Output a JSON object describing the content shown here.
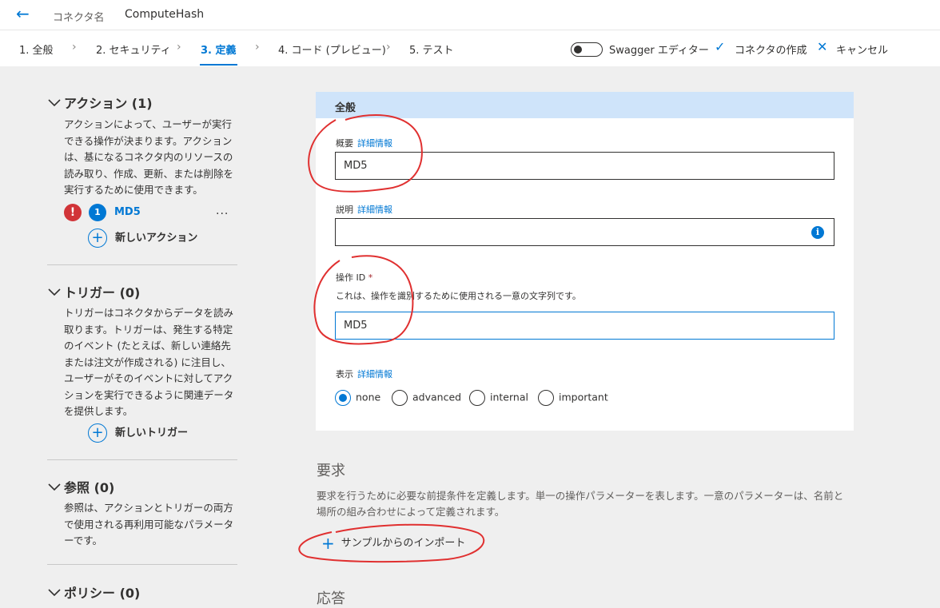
{
  "header": {
    "back_icon": "arrow-left-icon",
    "connector_label": "コネクタ名",
    "connector_name": "ComputeHash"
  },
  "tabs": [
    {
      "label": "1. 全般"
    },
    {
      "label": "2. セキュリティ"
    },
    {
      "label": "3. 定義",
      "active": true
    },
    {
      "label": "4. コード (プレビュー)"
    },
    {
      "label": "5. テスト"
    }
  ],
  "toolbar": {
    "swagger_label": "Swagger エディター",
    "create_label": "コネクタの作成",
    "cancel_label": "キャンセル"
  },
  "sidebar": {
    "actions": {
      "title": "アクション (1)",
      "description": "アクションによって、ユーザーが実行できる操作が決まります。アクションは、基になるコネクタ内のリソースの読み取り、作成、更新、または削除を実行するために使用できます。",
      "item_badge": "1",
      "item_name": "MD5",
      "more": "...",
      "add_label": "新しいアクション"
    },
    "triggers": {
      "title": "トリガー (0)",
      "description": "トリガーはコネクタからデータを読み取ります。トリガーは、発生する特定のイベント (たとえば、新しい連絡先または注文が作成される) に注目し、ユーザーがそのイベントに対してアクションを実行できるように関連データを提供します。",
      "add_label": "新しいトリガー"
    },
    "references": {
      "title": "参照 (0)",
      "description": "参照は、アクションとトリガーの両方で使用される再利用可能なパラメーターです。"
    },
    "policies": {
      "title": "ポリシー (0)"
    }
  },
  "general": {
    "title": "全般",
    "summary_label": "概要",
    "summary_link": "詳細情報",
    "summary_value": "MD5",
    "description_label": "説明",
    "description_link": "詳細情報",
    "description_value": "",
    "operation_id_label": "操作 ID",
    "required_mark": "*",
    "operation_id_help": "これは、操作を識別するために使用される一意の文字列です。",
    "operation_id_value": "MD5",
    "visibility_label": "表示",
    "visibility_link": "詳細情報",
    "visibility_options": [
      "none",
      "advanced",
      "internal",
      "important"
    ],
    "visibility_selected": "none"
  },
  "request": {
    "title": "要求",
    "description": "要求を行うために必要な前提条件を定義します。単一の操作パラメーターを表します。一意のパラメーターは、名前と場所の組み合わせによって定義されます。",
    "import_label": "サンプルからのインポート"
  },
  "response": {
    "title": "応答"
  },
  "colors": {
    "accent": "#0078d4",
    "error": "#d13438",
    "annotation": "#e03030",
    "card_header": "#cfe4fa"
  }
}
